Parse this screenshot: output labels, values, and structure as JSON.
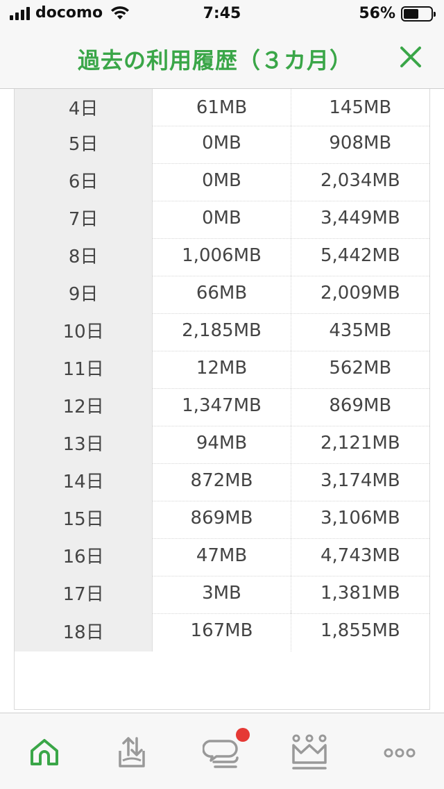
{
  "status": {
    "carrier": "docomo",
    "time": "7:45",
    "battery": "56%",
    "battery_level": 0.56
  },
  "header": {
    "title": "過去の利用履歴（３カ月）"
  },
  "table": {
    "rows": [
      {
        "day": "4日",
        "col1": "61MB",
        "col2": "145MB"
      },
      {
        "day": "5日",
        "col1": "0MB",
        "col2": "908MB"
      },
      {
        "day": "6日",
        "col1": "0MB",
        "col2": "2,034MB"
      },
      {
        "day": "7日",
        "col1": "0MB",
        "col2": "3,449MB"
      },
      {
        "day": "8日",
        "col1": "1,006MB",
        "col2": "5,442MB"
      },
      {
        "day": "9日",
        "col1": "66MB",
        "col2": "2,009MB"
      },
      {
        "day": "10日",
        "col1": "2,185MB",
        "col2": "435MB"
      },
      {
        "day": "11日",
        "col1": "12MB",
        "col2": "562MB"
      },
      {
        "day": "12日",
        "col1": "1,347MB",
        "col2": "869MB"
      },
      {
        "day": "13日",
        "col1": "94MB",
        "col2": "2,121MB"
      },
      {
        "day": "14日",
        "col1": "872MB",
        "col2": "3,174MB"
      },
      {
        "day": "15日",
        "col1": "869MB",
        "col2": "3,106MB"
      },
      {
        "day": "16日",
        "col1": "47MB",
        "col2": "4,743MB"
      },
      {
        "day": "17日",
        "col1": "3MB",
        "col2": "1,381MB"
      },
      {
        "day": "18日",
        "col1": "167MB",
        "col2": "1,855MB"
      }
    ]
  },
  "tabs": [
    {
      "icon": "home-icon",
      "active": true
    },
    {
      "icon": "data-charge-icon",
      "active": false
    },
    {
      "icon": "chat-icon",
      "active": false,
      "badge": true
    },
    {
      "icon": "crown-icon",
      "active": false
    },
    {
      "icon": "more-icon",
      "active": false
    }
  ],
  "colors": {
    "accent": "#3aa648",
    "inactive_icon": "#999999",
    "badge": "#e53935"
  }
}
